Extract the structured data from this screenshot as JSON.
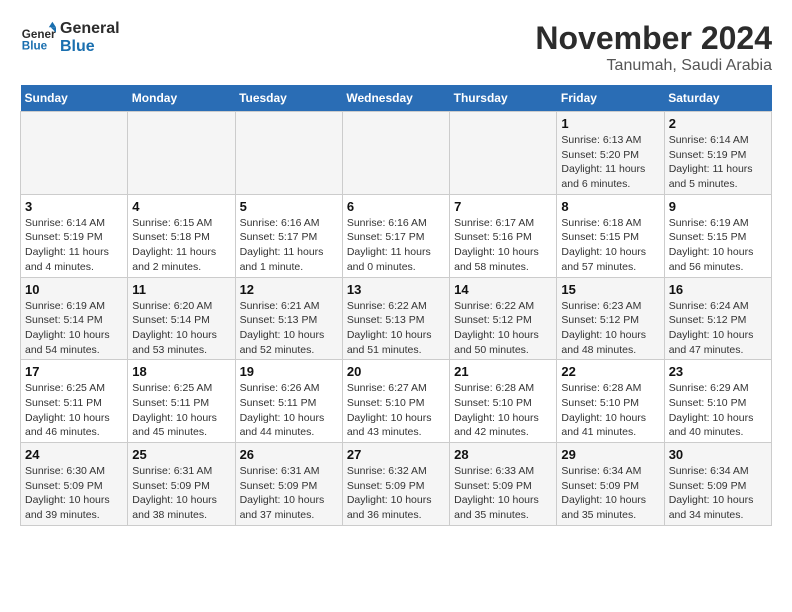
{
  "header": {
    "logo_line1": "General",
    "logo_line2": "Blue",
    "title": "November 2024",
    "subtitle": "Tanumah, Saudi Arabia"
  },
  "weekdays": [
    "Sunday",
    "Monday",
    "Tuesday",
    "Wednesday",
    "Thursday",
    "Friday",
    "Saturday"
  ],
  "weeks": [
    [
      {
        "day": "",
        "info": ""
      },
      {
        "day": "",
        "info": ""
      },
      {
        "day": "",
        "info": ""
      },
      {
        "day": "",
        "info": ""
      },
      {
        "day": "",
        "info": ""
      },
      {
        "day": "1",
        "info": "Sunrise: 6:13 AM\nSunset: 5:20 PM\nDaylight: 11 hours\nand 6 minutes."
      },
      {
        "day": "2",
        "info": "Sunrise: 6:14 AM\nSunset: 5:19 PM\nDaylight: 11 hours\nand 5 minutes."
      }
    ],
    [
      {
        "day": "3",
        "info": "Sunrise: 6:14 AM\nSunset: 5:19 PM\nDaylight: 11 hours\nand 4 minutes."
      },
      {
        "day": "4",
        "info": "Sunrise: 6:15 AM\nSunset: 5:18 PM\nDaylight: 11 hours\nand 2 minutes."
      },
      {
        "day": "5",
        "info": "Sunrise: 6:16 AM\nSunset: 5:17 PM\nDaylight: 11 hours\nand 1 minute."
      },
      {
        "day": "6",
        "info": "Sunrise: 6:16 AM\nSunset: 5:17 PM\nDaylight: 11 hours\nand 0 minutes."
      },
      {
        "day": "7",
        "info": "Sunrise: 6:17 AM\nSunset: 5:16 PM\nDaylight: 10 hours\nand 58 minutes."
      },
      {
        "day": "8",
        "info": "Sunrise: 6:18 AM\nSunset: 5:15 PM\nDaylight: 10 hours\nand 57 minutes."
      },
      {
        "day": "9",
        "info": "Sunrise: 6:19 AM\nSunset: 5:15 PM\nDaylight: 10 hours\nand 56 minutes."
      }
    ],
    [
      {
        "day": "10",
        "info": "Sunrise: 6:19 AM\nSunset: 5:14 PM\nDaylight: 10 hours\nand 54 minutes."
      },
      {
        "day": "11",
        "info": "Sunrise: 6:20 AM\nSunset: 5:14 PM\nDaylight: 10 hours\nand 53 minutes."
      },
      {
        "day": "12",
        "info": "Sunrise: 6:21 AM\nSunset: 5:13 PM\nDaylight: 10 hours\nand 52 minutes."
      },
      {
        "day": "13",
        "info": "Sunrise: 6:22 AM\nSunset: 5:13 PM\nDaylight: 10 hours\nand 51 minutes."
      },
      {
        "day": "14",
        "info": "Sunrise: 6:22 AM\nSunset: 5:12 PM\nDaylight: 10 hours\nand 50 minutes."
      },
      {
        "day": "15",
        "info": "Sunrise: 6:23 AM\nSunset: 5:12 PM\nDaylight: 10 hours\nand 48 minutes."
      },
      {
        "day": "16",
        "info": "Sunrise: 6:24 AM\nSunset: 5:12 PM\nDaylight: 10 hours\nand 47 minutes."
      }
    ],
    [
      {
        "day": "17",
        "info": "Sunrise: 6:25 AM\nSunset: 5:11 PM\nDaylight: 10 hours\nand 46 minutes."
      },
      {
        "day": "18",
        "info": "Sunrise: 6:25 AM\nSunset: 5:11 PM\nDaylight: 10 hours\nand 45 minutes."
      },
      {
        "day": "19",
        "info": "Sunrise: 6:26 AM\nSunset: 5:11 PM\nDaylight: 10 hours\nand 44 minutes."
      },
      {
        "day": "20",
        "info": "Sunrise: 6:27 AM\nSunset: 5:10 PM\nDaylight: 10 hours\nand 43 minutes."
      },
      {
        "day": "21",
        "info": "Sunrise: 6:28 AM\nSunset: 5:10 PM\nDaylight: 10 hours\nand 42 minutes."
      },
      {
        "day": "22",
        "info": "Sunrise: 6:28 AM\nSunset: 5:10 PM\nDaylight: 10 hours\nand 41 minutes."
      },
      {
        "day": "23",
        "info": "Sunrise: 6:29 AM\nSunset: 5:10 PM\nDaylight: 10 hours\nand 40 minutes."
      }
    ],
    [
      {
        "day": "24",
        "info": "Sunrise: 6:30 AM\nSunset: 5:09 PM\nDaylight: 10 hours\nand 39 minutes."
      },
      {
        "day": "25",
        "info": "Sunrise: 6:31 AM\nSunset: 5:09 PM\nDaylight: 10 hours\nand 38 minutes."
      },
      {
        "day": "26",
        "info": "Sunrise: 6:31 AM\nSunset: 5:09 PM\nDaylight: 10 hours\nand 37 minutes."
      },
      {
        "day": "27",
        "info": "Sunrise: 6:32 AM\nSunset: 5:09 PM\nDaylight: 10 hours\nand 36 minutes."
      },
      {
        "day": "28",
        "info": "Sunrise: 6:33 AM\nSunset: 5:09 PM\nDaylight: 10 hours\nand 35 minutes."
      },
      {
        "day": "29",
        "info": "Sunrise: 6:34 AM\nSunset: 5:09 PM\nDaylight: 10 hours\nand 35 minutes."
      },
      {
        "day": "30",
        "info": "Sunrise: 6:34 AM\nSunset: 5:09 PM\nDaylight: 10 hours\nand 34 minutes."
      }
    ]
  ]
}
